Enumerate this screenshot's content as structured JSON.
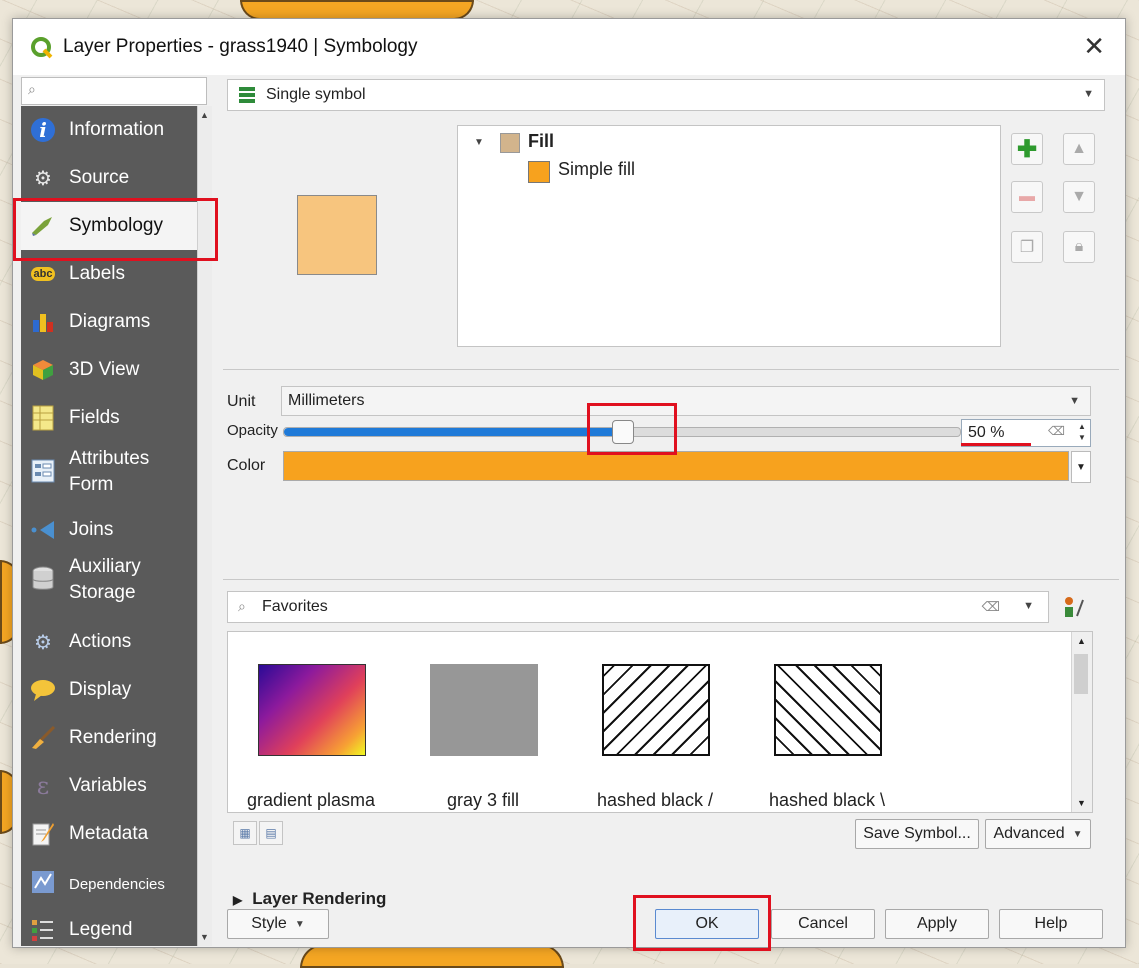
{
  "window": {
    "title": "Layer Properties - grass1940 | Symbology",
    "close_glyph": "✕"
  },
  "sidebar": {
    "search_placeholder": "",
    "items": [
      {
        "label": "Information",
        "icon": "information-icon",
        "glyph": "i",
        "color": "#2f6fd6"
      },
      {
        "label": "Source",
        "icon": "source-icon",
        "glyph": "⚙",
        "color": "#e0e0e0"
      },
      {
        "label": "Symbology",
        "icon": "symbology-icon",
        "glyph": "🖌",
        "color": "#8fb34a"
      },
      {
        "label": "Labels",
        "icon": "labels-icon",
        "glyph": "abc",
        "color": "#f0c020"
      },
      {
        "label": "Diagrams",
        "icon": "diagrams-icon",
        "glyph": "▮",
        "color": "#e04020"
      },
      {
        "label": "3D View",
        "icon": "3d-view-icon",
        "glyph": "◆",
        "color": "#e05a2a"
      },
      {
        "label": "Fields",
        "icon": "fields-icon",
        "glyph": "▤",
        "color": "#f0e060"
      },
      {
        "label": "Attributes\nForm",
        "icon": "attributes-form-icon",
        "glyph": "▦",
        "color": "#cfe0f0"
      },
      {
        "label": "Joins",
        "icon": "joins-icon",
        "glyph": "◀",
        "color": "#4a90d0"
      },
      {
        "label": "Auxiliary\nStorage",
        "icon": "auxiliary-storage-icon",
        "glyph": "▥",
        "color": "#dcdcdc"
      },
      {
        "label": "Actions",
        "icon": "actions-icon",
        "glyph": "⚙",
        "color": "#a8c0e0"
      },
      {
        "label": "Display",
        "icon": "display-icon",
        "glyph": "💬",
        "color": "#f0c030"
      },
      {
        "label": "Rendering",
        "icon": "rendering-icon",
        "glyph": "🖌",
        "color": "#e0a040"
      },
      {
        "label": "Variables",
        "icon": "variables-icon",
        "glyph": "ε",
        "color": "#b0a0c0"
      },
      {
        "label": "Metadata",
        "icon": "metadata-icon",
        "glyph": "✎",
        "color": "#f0f0f0"
      },
      {
        "label": "Dependencies",
        "icon": "dependencies-icon",
        "glyph": "▧",
        "color": "#80a0d0"
      },
      {
        "label": "Legend",
        "icon": "legend-icon",
        "glyph": "☰",
        "color": "#e0a040"
      }
    ],
    "active_index": 2
  },
  "renderer": {
    "label": "Single symbol"
  },
  "symbol_tree": {
    "root_label": "Fill",
    "child_label": "Simple fill",
    "root_color": "#d2b48c",
    "child_color": "#f7a21e"
  },
  "preview": {
    "color": "#f7c57e"
  },
  "properties": {
    "unit_label": "Unit",
    "unit_value": "Millimeters",
    "opacity_label": "Opacity",
    "opacity_value": "50 %",
    "opacity_fraction": 0.5,
    "color_label": "Color",
    "color_value": "#f7a21e"
  },
  "favorites": {
    "search_value": "Favorites",
    "symbols": [
      {
        "label": "gradient  plasma",
        "icon": "gradient-plasma-thumb"
      },
      {
        "label": "gray 3 fill",
        "icon": "gray-fill-thumb"
      },
      {
        "label": "hashed black /",
        "icon": "hashed-forward-thumb"
      },
      {
        "label": "hashed black \\",
        "icon": "hashed-back-thumb"
      }
    ]
  },
  "buttons": {
    "save_symbol": "Save Symbol...",
    "advanced": "Advanced",
    "style": "Style",
    "ok": "OK",
    "cancel": "Cancel",
    "apply": "Apply",
    "help": "Help"
  },
  "layer_rendering": {
    "label": "Layer Rendering"
  },
  "highlight_color": "#e0101f"
}
